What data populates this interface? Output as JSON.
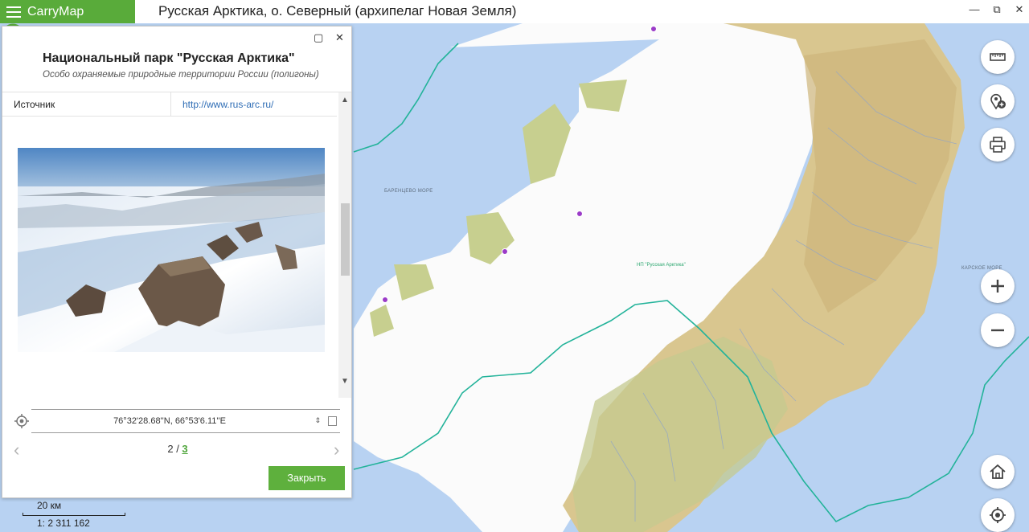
{
  "app": {
    "name": "CarryMap",
    "window_title": "Русская Арктика, о. Северный (архипелаг Новая Земля)"
  },
  "window_controls": {
    "minimize": "—",
    "restore": "⧉",
    "close": "✕"
  },
  "map": {
    "labels": {
      "barents_sea": "БАРЕНЦЕВО МОРЕ",
      "kara_sea": "КАРСКОЕ МОРЕ",
      "park_area": "НП \"Русская Арктика\""
    },
    "colors": {
      "sea": "#b8d2f2",
      "glacier": "#ffffff",
      "land": "#d8c48c",
      "boundary": "#23b39a",
      "accent": "#59ab3a"
    },
    "buttons": [
      "ruler-icon",
      "add-location-icon",
      "printer-icon",
      "zoom-in-icon",
      "zoom-out-icon",
      "home-icon",
      "my-location-icon"
    ]
  },
  "panel": {
    "title": "Национальный парк \"Русская Арктика\"",
    "subtitle": "Особо охраняемые природные территории России (полигоны)",
    "source_label": "Источник",
    "source_link": "http://www.rus-arc.ru/",
    "coordinates": "76°32'28.68''N, 66°53'6.11''E",
    "pager": {
      "current": "2",
      "separator": " / ",
      "total": "3"
    },
    "close_label": "Закрыть"
  },
  "scale": {
    "distance": "20 км",
    "ratio": "1: 2 311 162"
  }
}
